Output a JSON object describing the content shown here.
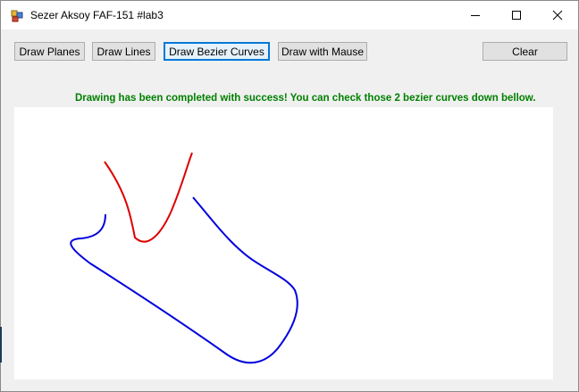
{
  "window": {
    "title": "Sezer Aksoy FAF-151 #lab3"
  },
  "toolbar": {
    "draw_planes": "Draw Planes",
    "draw_lines": "Draw Lines",
    "draw_bezier": "Draw Bezier Curves",
    "draw_mouse": "Draw with Mause",
    "clear": "Clear"
  },
  "status": {
    "message": "Drawing has been completed with success! You can check those 2 bezier curves down bellow."
  },
  "colors": {
    "status_text": "#008000",
    "red_curve": "#dd0000",
    "blue_curve": "#0000dd",
    "focus_border": "#0078d7"
  },
  "icons": {
    "app": "app-window-icon",
    "minimize": "minimize-icon",
    "maximize": "maximize-icon",
    "close": "close-icon"
  }
}
